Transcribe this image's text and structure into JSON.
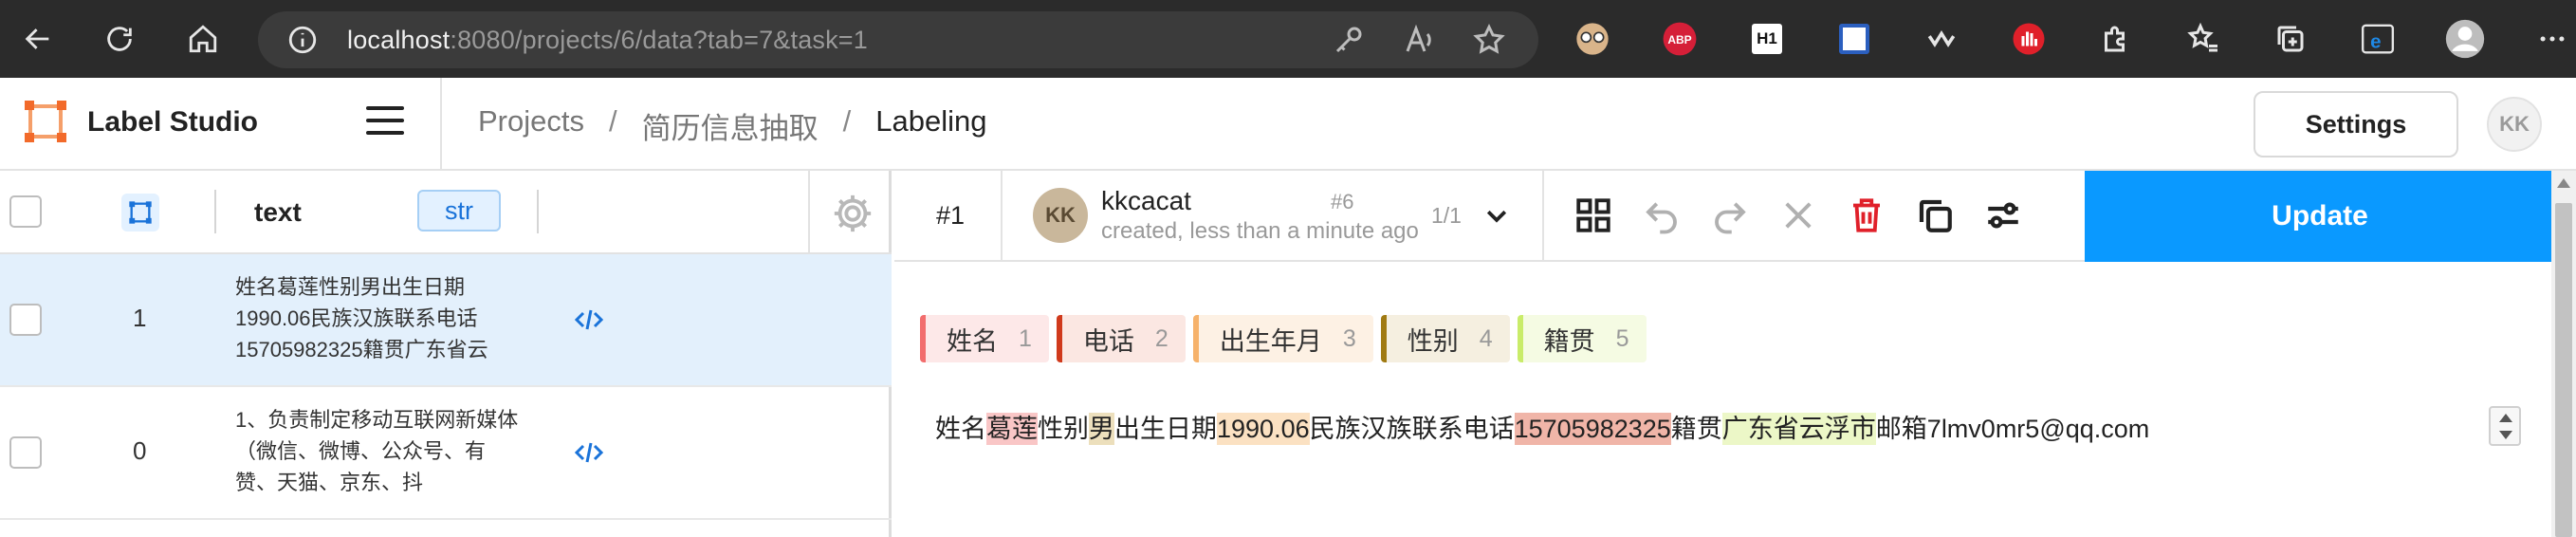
{
  "browser": {
    "url_host": "localhost",
    "url_rest": ":8080/projects/6/data?tab=7&task=1",
    "extensions": [
      "abp-icon",
      "h1-icon",
      "notes-icon",
      "wave-icon",
      "hand-icon",
      "puzzle-icon",
      "favorites-icon",
      "collections-icon",
      "ie-mode-icon",
      "profile-icon",
      "more-icon"
    ],
    "abp_label": "ABP",
    "h1_label": "H1"
  },
  "header": {
    "brand": "Label Studio",
    "breadcrumb": [
      "Projects",
      "简历信息抽取",
      "Labeling"
    ],
    "separator": "/",
    "settings_label": "Settings",
    "user_initials": "KK"
  },
  "table": {
    "column_text": "text",
    "column_type": "str",
    "rows": [
      {
        "id": "1",
        "text": "姓名葛莲性别男出生日期1990.06民族汉族联系电话15705982325籍贯广东省云",
        "selected": true
      },
      {
        "id": "0",
        "text": "1、负责制定移动互联网新媒体（微信、微博、公众号、有赞、天猫、京东、抖",
        "selected": false
      }
    ]
  },
  "annotation": {
    "task_id": "#1",
    "user_initials": "KK",
    "user": "kkcacat",
    "number": "#6",
    "time": "created, less than a minute ago",
    "count": "1/1",
    "update_label": "Update"
  },
  "labels": [
    {
      "name": "姓名",
      "hotkey": "1",
      "color": "#f26d6d",
      "bg": "#fde8e8"
    },
    {
      "name": "电话",
      "hotkey": "2",
      "color": "#d03a1c",
      "bg": "#fbe7e2"
    },
    {
      "name": "出生年月",
      "hotkey": "3",
      "color": "#f6b26b",
      "bg": "#fdf1e4"
    },
    {
      "name": "性别",
      "hotkey": "4",
      "color": "#a07a12",
      "bg": "#f5efe0"
    },
    {
      "name": "籍贯",
      "hotkey": "5",
      "color": "#c9ec6a",
      "bg": "#f5fbe3"
    }
  ],
  "document": {
    "segments": [
      {
        "text": "姓名",
        "label": null
      },
      {
        "text": "葛莲",
        "label": "姓名",
        "bg": "#f9c6c6"
      },
      {
        "text": "性别",
        "label": null
      },
      {
        "text": "男",
        "label": "性别",
        "bg": "#ecdfbc"
      },
      {
        "text": "出生日期",
        "label": null
      },
      {
        "text": "1990.06",
        "label": "出生年月",
        "bg": "#fbe1c2"
      },
      {
        "text": "民族汉族联系电话",
        "label": null
      },
      {
        "text": "15705982325",
        "label": "电话",
        "bg": "#f0b5a8"
      },
      {
        "text": "籍贯",
        "label": null
      },
      {
        "text": "广东省云浮市",
        "label": "籍贯",
        "bg": "#ecf7c7"
      },
      {
        "text": "邮箱7lmv0mr5@qq.com",
        "label": null
      }
    ]
  }
}
